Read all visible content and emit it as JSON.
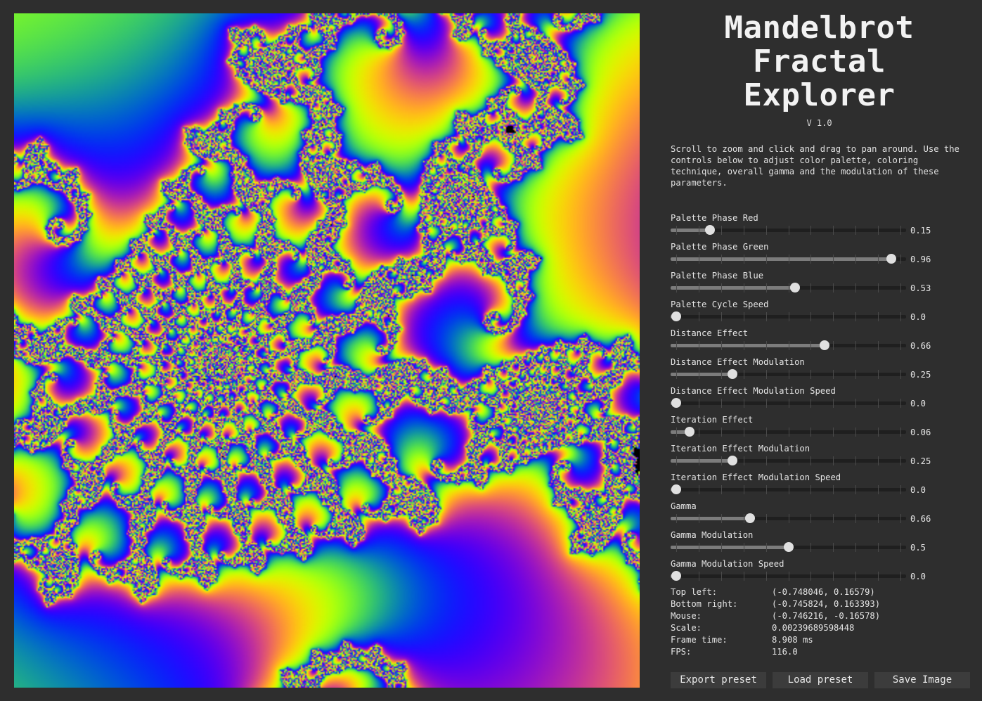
{
  "app": {
    "title_lines": [
      "Mandelbrot",
      "Fractal",
      "Explorer"
    ],
    "version": "V 1.0",
    "description": "Scroll to zoom and click and drag to pan around. Use the controls below to adjust color palette, coloring technique, overall gamma and the modulation of these parameters."
  },
  "sliders": [
    {
      "label": "Palette Phase Red",
      "value": "0.15",
      "fraction": 0.15
    },
    {
      "label": "Palette Phase Green",
      "value": "0.96",
      "fraction": 0.96
    },
    {
      "label": "Palette Phase Blue",
      "value": "0.53",
      "fraction": 0.53
    },
    {
      "label": "Palette Cycle Speed",
      "value": "0.0",
      "fraction": 0.0
    },
    {
      "label": "Distance Effect",
      "value": "0.66",
      "fraction": 0.66
    },
    {
      "label": "Distance Effect Modulation",
      "value": "0.25",
      "fraction": 0.25
    },
    {
      "label": "Distance Effect Modulation Speed",
      "value": "0.0",
      "fraction": 0.0
    },
    {
      "label": "Iteration Effect",
      "value": "0.06",
      "fraction": 0.06
    },
    {
      "label": "Iteration Effect Modulation",
      "value": "0.25",
      "fraction": 0.25
    },
    {
      "label": "Iteration Effect Modulation Speed",
      "value": "0.0",
      "fraction": 0.0
    },
    {
      "label": "Gamma",
      "value": "0.66",
      "fraction": 0.33
    },
    {
      "label": "Gamma Modulation",
      "value": "0.5",
      "fraction": 0.5
    },
    {
      "label": "Gamma Modulation Speed",
      "value": "0.0",
      "fraction": 0.0
    }
  ],
  "stats": [
    {
      "label": "Top left:",
      "value": "(-0.748046, 0.16579)"
    },
    {
      "label": "Bottom right:",
      "value": "(-0.745824, 0.163393)"
    },
    {
      "label": "Mouse:",
      "value": "(-0.746216, -0.16578)"
    },
    {
      "label": "Scale:",
      "value": "0.00239689598448"
    },
    {
      "label": "Frame time:",
      "value": "8.908 ms"
    },
    {
      "label": "FPS:",
      "value": "116.0"
    }
  ],
  "buttons": {
    "export": "Export preset",
    "load": "Load preset",
    "save": "Save Image"
  },
  "view": {
    "top_left": [
      -0.748046,
      0.16579
    ],
    "bottom_right": [
      -0.745824,
      0.163393
    ]
  }
}
